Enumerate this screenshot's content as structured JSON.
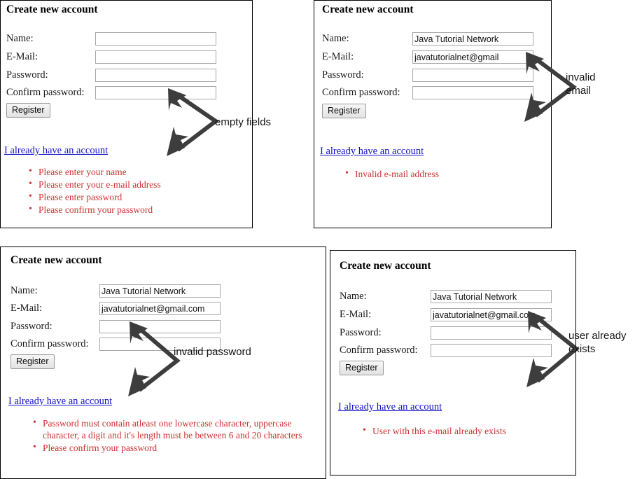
{
  "panels": [
    {
      "id": "empty-fields",
      "title": "Create new account",
      "fields": [
        {
          "label": "Name:",
          "value": ""
        },
        {
          "label": "E-Mail:",
          "value": ""
        },
        {
          "label": "Password:",
          "value": ""
        },
        {
          "label": "Confirm password:",
          "value": ""
        }
      ],
      "submit_label": "Register",
      "link_label": "I already have an account",
      "errors": [
        "Please enter your name",
        "Please enter your e-mail address",
        "Please enter password",
        "Please confirm your password"
      ],
      "annotation": "empty fields"
    },
    {
      "id": "invalid-email",
      "title": "Create new account",
      "fields": [
        {
          "label": "Name:",
          "value": "Java Tutorial Network"
        },
        {
          "label": "E-Mail:",
          "value": "javatutorialnet@gmail"
        },
        {
          "label": "Password:",
          "value": ""
        },
        {
          "label": "Confirm password:",
          "value": ""
        }
      ],
      "submit_label": "Register",
      "link_label": "I already have an account",
      "errors": [
        "Invalid e-mail address"
      ],
      "annotation": "invalid\nemail"
    },
    {
      "id": "invalid-password",
      "title": "Create new account",
      "fields": [
        {
          "label": "Name:",
          "value": "Java Tutorial Network"
        },
        {
          "label": "E-Mail:",
          "value": "javatutorialnet@gmail.com"
        },
        {
          "label": "Password:",
          "value": ""
        },
        {
          "label": "Confirm password:",
          "value": ""
        }
      ],
      "submit_label": "Register",
      "link_label": "I already have an account",
      "errors": [
        "Password must contain atleast one lowercase character, uppercase character, a digit and it's length must be between 6 and 20 characters",
        "Please confirm your password"
      ],
      "annotation": "invalid password"
    },
    {
      "id": "user-exists",
      "title": "Create new account",
      "fields": [
        {
          "label": "Name:",
          "value": "Java Tutorial Network"
        },
        {
          "label": "E-Mail:",
          "value": "javatutorialnet@gmail.com"
        },
        {
          "label": "Password:",
          "value": ""
        },
        {
          "label": "Confirm password:",
          "value": ""
        }
      ],
      "submit_label": "Register",
      "link_label": "I already have an account",
      "errors": [
        "User with this e-mail already exists"
      ],
      "annotation": "user already\nexists"
    }
  ],
  "colors": {
    "error_text": "#cc3333",
    "link": "#1414c8",
    "annotation": "#141414",
    "panel_border": "#000000",
    "input_border": "#a8a8a8"
  }
}
